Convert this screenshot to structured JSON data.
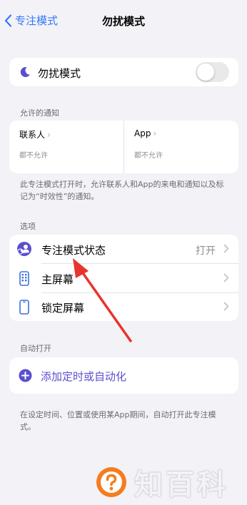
{
  "nav": {
    "back_label": "专注模式",
    "title": "勿扰模式"
  },
  "focus": {
    "label": "勿扰模式",
    "toggle_on": false
  },
  "allowed": {
    "section_title": "允许的通知",
    "people": {
      "title": "联系人",
      "subtitle": "都不允许"
    },
    "apps": {
      "title": "App",
      "subtitle": "都不允许"
    },
    "footnote": "此专注模式打开时，允许联系人和App的来电和通知以及标记为“时效性”的通知。"
  },
  "options": {
    "section_title": "选项",
    "items": [
      {
        "label": "专注模式状态",
        "value": "打开"
      },
      {
        "label": "主屏幕",
        "value": ""
      },
      {
        "label": "锁定屏幕",
        "value": ""
      }
    ]
  },
  "auto": {
    "section_title": "自动打开",
    "add_label": "添加定时或自动化",
    "footnote": "在设定时间、位置或使用某App期间，自动打开此专注模式。"
  },
  "watermark": {
    "text": "知百科"
  },
  "colors": {
    "accent_blue": "#3478f6",
    "focus_purple": "#5a4fcf",
    "arrow_red": "#e8342e",
    "watermark_orange": "#f57c1f"
  },
  "icons": {
    "back": "chevron-left-icon",
    "moon": "moon-icon",
    "status": "person-moon-icon",
    "home_screen": "phone-grid-icon",
    "lock_screen": "phone-icon",
    "add": "plus-circle-icon"
  }
}
